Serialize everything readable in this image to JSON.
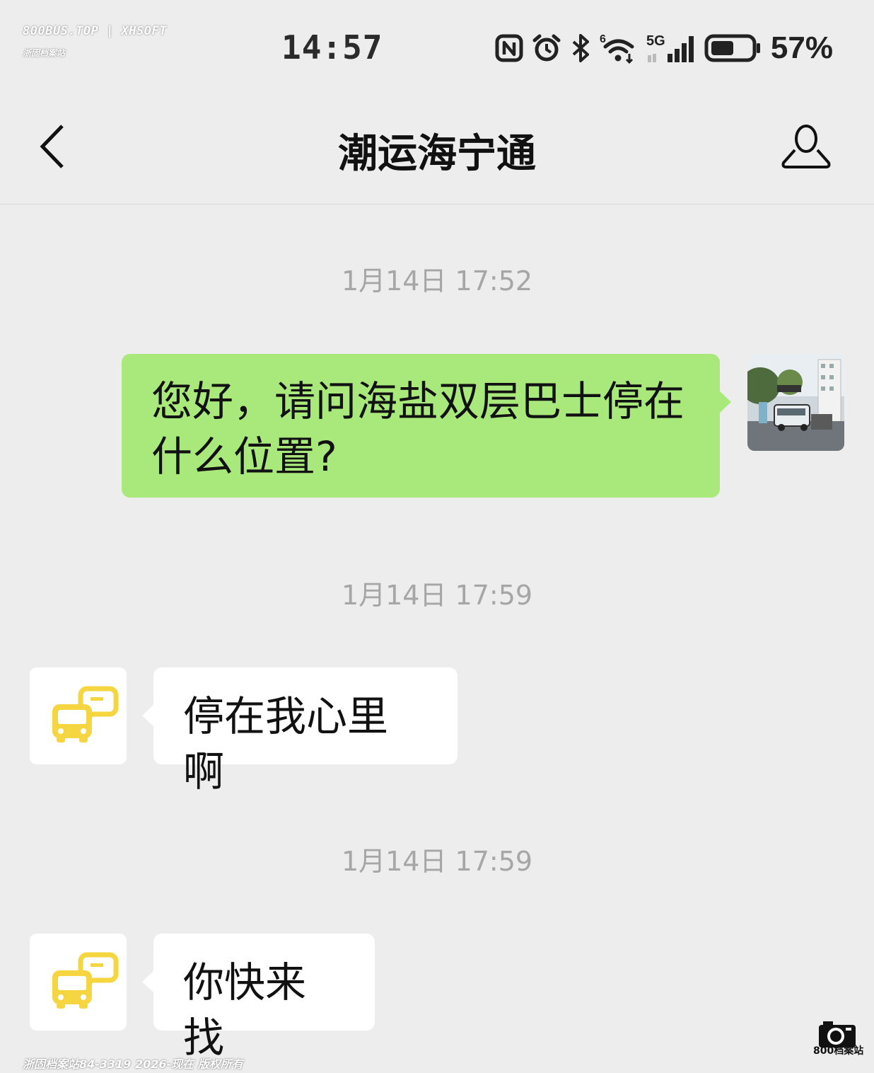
{
  "watermark": {
    "top_line": "800BUS.TOP | XHSOFT",
    "top_sub": "浙固档案站",
    "bottom": "浙固档案站84-3319 2026-现在 版权所有",
    "corner_logo": "800档案站"
  },
  "status_bar": {
    "time": "14:57",
    "network_label": "5G",
    "wifi_label": "6",
    "battery_percent": "57%",
    "battery_level": 0.57,
    "icons": [
      "nfc-icon",
      "alarm-icon",
      "bluetooth-icon",
      "wifi-icon",
      "signal-icon",
      "battery-icon"
    ]
  },
  "navbar": {
    "title": "潮运海宁通",
    "back_icon": "chevron-left-icon",
    "profile_icon": "person-icon"
  },
  "messages": [
    {
      "type": "timestamp",
      "text": "1月14日 17:52"
    },
    {
      "type": "outgoing",
      "text": "您好，请问海盐双层巴士停在什么位置?",
      "avatar": "user-photo-avatar"
    },
    {
      "type": "timestamp",
      "text": "1月14日 17:59"
    },
    {
      "type": "incoming",
      "text": "停在我心里啊",
      "avatar": "bus-chat-logo"
    },
    {
      "type": "timestamp",
      "text": "1月14日 17:59"
    },
    {
      "type": "incoming",
      "text": "你快来找",
      "avatar": "bus-chat-logo"
    }
  ],
  "colors": {
    "background": "#ededed",
    "outgoing_bubble": "#a9e97c",
    "incoming_bubble": "#ffffff",
    "timestamp_text": "#a6a6a6",
    "bus_logo": "#f5d641"
  }
}
